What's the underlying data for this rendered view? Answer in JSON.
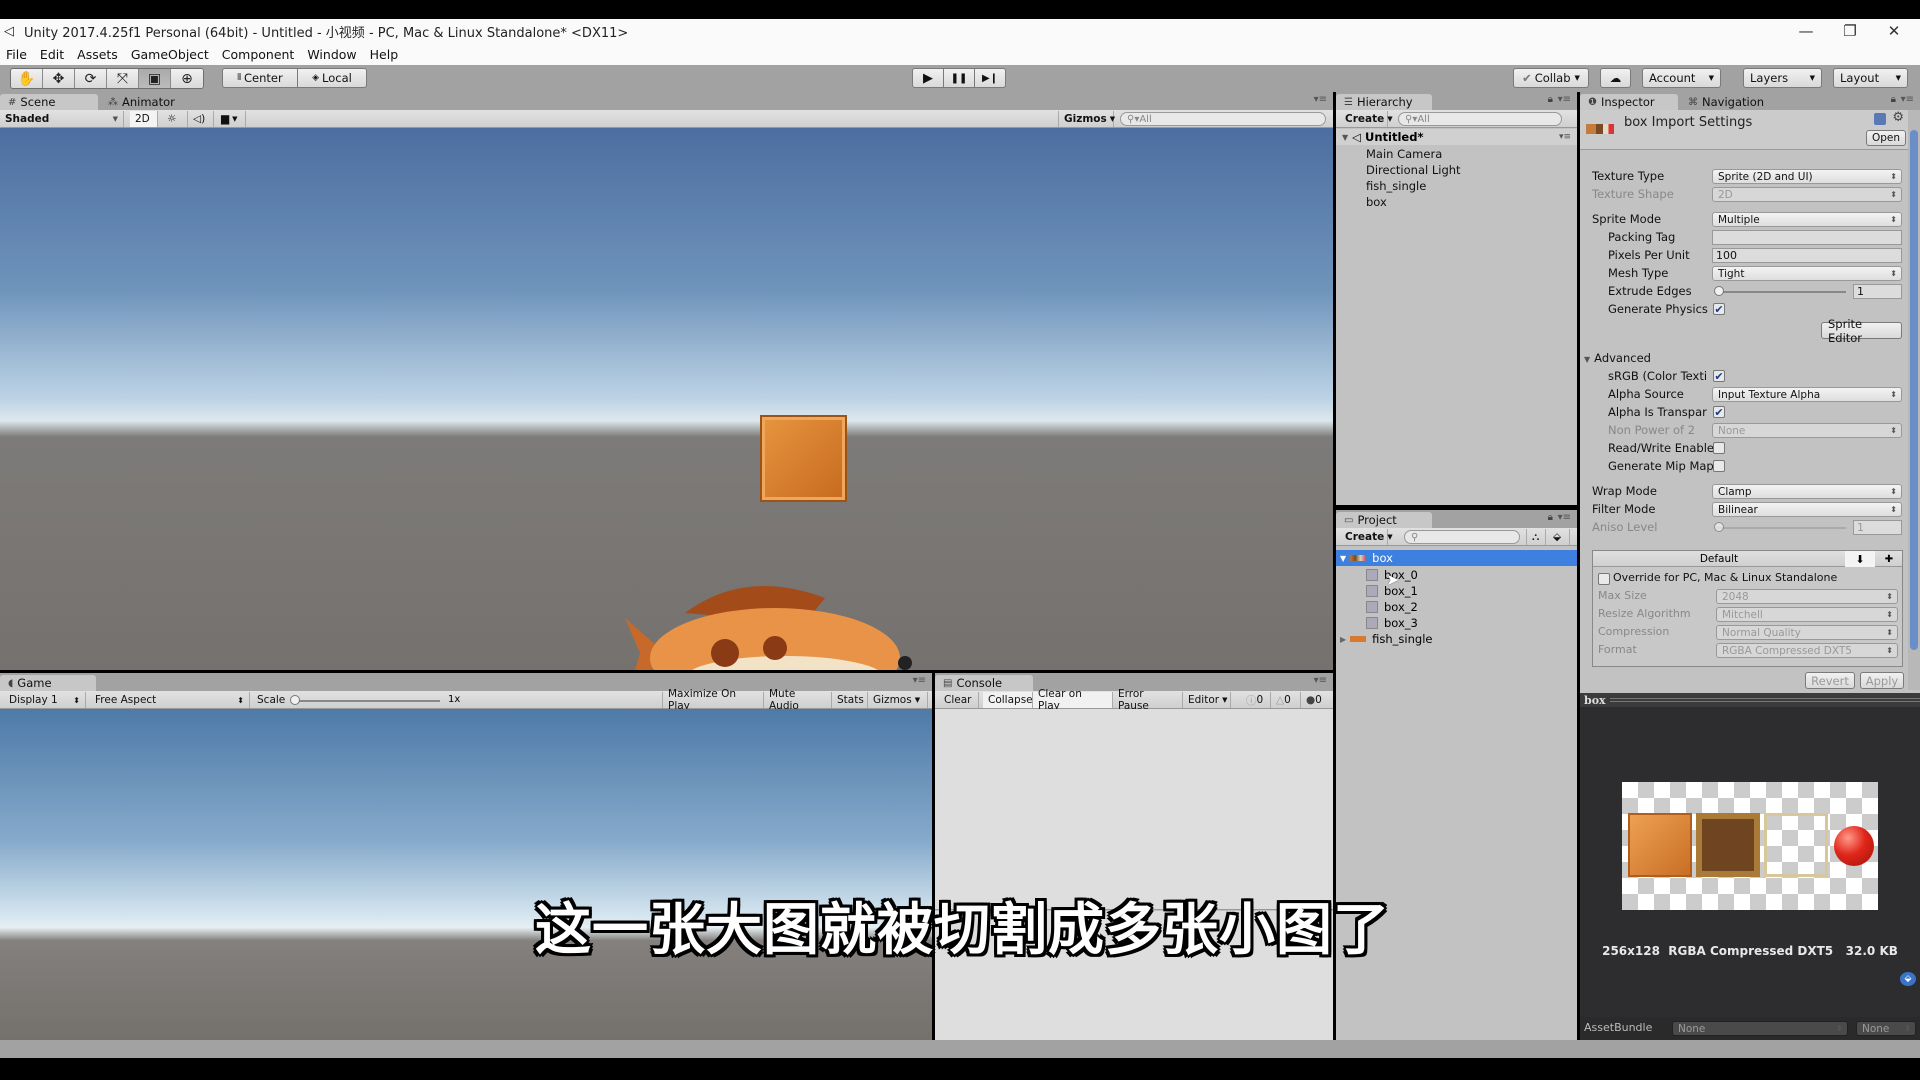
{
  "window": {
    "title": "Unity 2017.4.25f1 Personal (64bit) - Untitled - 小视频 - PC, Mac & Linux Standalone* <DX11>",
    "controls": {
      "minimize": "—",
      "restore": "❐",
      "close": "✕"
    }
  },
  "menu": [
    "File",
    "Edit",
    "Assets",
    "GameObject",
    "Component",
    "Window",
    "Help"
  ],
  "toolbar": {
    "tools": [
      {
        "name": "hand-tool",
        "icon": "✋"
      },
      {
        "name": "move-tool",
        "icon": "✥"
      },
      {
        "name": "rotate-tool",
        "icon": "⟳"
      },
      {
        "name": "scale-tool",
        "icon": "⤧"
      },
      {
        "name": "rect-tool",
        "icon": "▣"
      },
      {
        "name": "transform-tool",
        "icon": "⊕"
      }
    ],
    "pivot": "Center",
    "pivot_rotation": "Local",
    "play": "▶",
    "pause": "❚❚",
    "step": "▶❙",
    "collab": "Collab",
    "cloud": "☁",
    "account": "Account",
    "layers": "Layers",
    "layout": "Layout"
  },
  "scene": {
    "tabs": [
      "Scene",
      "Animator"
    ],
    "shading": "Shaded",
    "mode_2d": "2D",
    "gizmos": "Gizmos",
    "search_placeholder": "All"
  },
  "game": {
    "tab": "Game",
    "display": "Display 1",
    "aspect": "Free Aspect",
    "scale_label": "Scale",
    "scale_value": "1x",
    "buttons": [
      "Maximize On Play",
      "Mute Audio",
      "Stats",
      "Gizmos"
    ]
  },
  "console": {
    "tab": "Console",
    "buttons": [
      "Clear",
      "Collapse",
      "Clear on Play",
      "Error Pause",
      "Editor"
    ],
    "counts": {
      "info": "0",
      "warning": "0",
      "error": "0"
    }
  },
  "hierarchy": {
    "tab": "Hierarchy",
    "create": "Create",
    "search_placeholder": "All",
    "scene_name": "Untitled*",
    "items": [
      "Main Camera",
      "Directional Light",
      "fish_single",
      "box"
    ]
  },
  "project": {
    "tab": "Project",
    "create": "Create",
    "items": [
      {
        "label": "box",
        "selected": true,
        "expanded": true
      },
      {
        "label": "box_0",
        "child": true
      },
      {
        "label": "box_1",
        "child": true
      },
      {
        "label": "box_2",
        "child": true
      },
      {
        "label": "box_3",
        "child": true
      },
      {
        "label": "fish_single",
        "expanded": false
      }
    ]
  },
  "inspector": {
    "tabs": [
      "Inspector",
      "Navigation"
    ],
    "title": "box Import Settings",
    "open": "Open",
    "fields": {
      "texture_type": {
        "label": "Texture Type",
        "value": "Sprite (2D and UI)"
      },
      "texture_shape": {
        "label": "Texture Shape",
        "value": "2D"
      },
      "sprite_mode": {
        "label": "Sprite Mode",
        "value": "Multiple"
      },
      "packing_tag": {
        "label": "Packing Tag",
        "value": ""
      },
      "pixels_per_unit": {
        "label": "Pixels Per Unit",
        "value": "100"
      },
      "mesh_type": {
        "label": "Mesh Type",
        "value": "Tight"
      },
      "extrude_edges": {
        "label": "Extrude Edges",
        "value": "1"
      },
      "generate_physics": {
        "label": "Generate Physics",
        "checked": true
      },
      "sprite_editor": "Sprite Editor",
      "advanced": "Advanced",
      "srgb": {
        "label": "sRGB (Color Texti",
        "checked": true
      },
      "alpha_source": {
        "label": "Alpha Source",
        "value": "Input Texture Alpha"
      },
      "alpha_is_transparency": {
        "label": "Alpha Is Transpar",
        "checked": true
      },
      "non_power_of_2": {
        "label": "Non Power of 2",
        "value": "None"
      },
      "read_write": {
        "label": "Read/Write Enable",
        "checked": false
      },
      "generate_mip_maps": {
        "label": "Generate Mip Map",
        "checked": false
      },
      "wrap_mode": {
        "label": "Wrap Mode",
        "value": "Clamp"
      },
      "filter_mode": {
        "label": "Filter Mode",
        "value": "Bilinear"
      },
      "aniso_level": {
        "label": "Aniso Level",
        "value": "1"
      }
    },
    "platform": {
      "default_tab": "Default",
      "override_label": "Override for PC, Mac & Linux Standalone",
      "max_size": {
        "label": "Max Size",
        "value": "2048"
      },
      "resize_algorithm": {
        "label": "Resize Algorithm",
        "value": "Mitchell"
      },
      "compression": {
        "label": "Compression",
        "value": "Normal Quality"
      },
      "format": {
        "label": "Format",
        "value": "RGBA Compressed DXT5"
      }
    },
    "revert": "Revert",
    "apply": "Apply",
    "preview": {
      "title": "box",
      "info": "256x128  RGBA Compressed DXT5   32.0 KB"
    },
    "asset_bundle": {
      "label": "AssetBundle",
      "value": "None",
      "variant": "None"
    }
  },
  "subtitle": "这一张大图就被切割成多张小图了"
}
